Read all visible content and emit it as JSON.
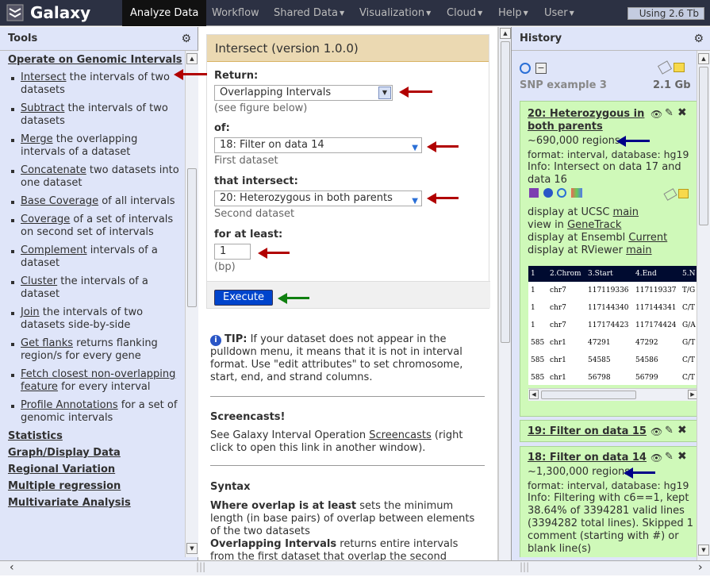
{
  "masthead": {
    "brand": "Galaxy",
    "nav": [
      "Analyze Data",
      "Workflow",
      "Shared Data",
      "Visualization",
      "Cloud",
      "Help",
      "User"
    ],
    "quota": "Using 2.6 Tb"
  },
  "tools_panel": {
    "title": "Tools",
    "section_title": "Operate on Genomic Intervals",
    "tools": [
      {
        "link": "Intersect",
        "rest": " the intervals of two datasets"
      },
      {
        "link": "Subtract",
        "rest": " the intervals of two datasets"
      },
      {
        "link": "Merge",
        "rest": " the overlapping intervals of a dataset"
      },
      {
        "link": "Concatenate",
        "rest": " two datasets into one dataset"
      },
      {
        "link": "Base Coverage",
        "rest": " of all intervals"
      },
      {
        "link": "Coverage",
        "rest": " of a set of intervals on second set of intervals"
      },
      {
        "link": "Complement",
        "rest": " intervals of a dataset"
      },
      {
        "link": "Cluster",
        "rest": " the intervals of a dataset"
      },
      {
        "link": "Join",
        "rest": " the intervals of two datasets side-by-side"
      },
      {
        "link": "Get flanks",
        "rest": " returns flanking region/s for every gene"
      },
      {
        "link": "Fetch closest non-overlapping feature",
        "rest": " for every interval"
      },
      {
        "link": "Profile Annotations",
        "rest": " for a set of genomic intervals"
      }
    ],
    "sections": [
      "Statistics",
      "Graph/Display Data",
      "Regional Variation",
      "Multiple regression",
      "Multivariate Analysis"
    ]
  },
  "form": {
    "title": "Intersect (version 1.0.0)",
    "return_label": "Return:",
    "return_value": "Overlapping Intervals",
    "return_hint": "(see figure below)",
    "of_label": "of:",
    "of_value": "18: Filter on data 14",
    "of_hint": "First dataset",
    "intersect_label": "that intersect:",
    "intersect_value": "20: Heterozygous in both parents",
    "intersect_hint": "Second dataset",
    "atleast_label": "for at least:",
    "atleast_value": "1",
    "atleast_hint": "(bp)",
    "execute": "Execute"
  },
  "help": {
    "tip_bold": "TIP:",
    "tip_text": " If your dataset does not appear in the pulldown menu, it means that it is not in interval format. Use \"edit attributes\" to set chromosome, start, end, and strand columns.",
    "screencasts_title": "Screencasts!",
    "screencasts_pre": "See Galaxy Interval Operation ",
    "screencasts_link": "Screencasts",
    "screencasts_post": " (right click to open this link in another window).",
    "syntax_title": "Syntax",
    "s1_bold": "Where overlap is at least",
    "s1_text": " sets the minimum length (in base pairs) of overlap between elements of the two datasets",
    "s2_bold": "Overlapping Intervals",
    "s2_text": " returns entire intervals from the first dataset that overlap the second dataset. The returned intervals are completely unchanged, and this"
  },
  "history": {
    "title": "History",
    "name": "SNP example 3",
    "size": "2.1 Gb",
    "ds20": {
      "title": "20: Heterozygous in both parents",
      "regions": "~690,000 regions",
      "format": "format: interval, database: hg19",
      "info": "Info: Intersect on data 17 and data 16",
      "d1_pre": "display at UCSC ",
      "d1_link": "main",
      "d2_pre": "view in ",
      "d2_link": "GeneTrack",
      "d3_pre": "display at Ensembl ",
      "d3_link": "Current",
      "d4_pre": "display at RViewer ",
      "d4_link": "main",
      "peek_header": [
        "1",
        "2.Chrom",
        "3.Start",
        "4.End",
        "5.N"
      ],
      "peek_rows": [
        [
          "1",
          "chr7",
          "117119336",
          "117119337",
          "T/G"
        ],
        [
          "1",
          "chr7",
          "117144340",
          "117144341",
          "C/T"
        ],
        [
          "1",
          "chr7",
          "117174423",
          "117174424",
          "G/A"
        ],
        [
          "585",
          "chr1",
          "47291",
          "47292",
          "G/T"
        ],
        [
          "585",
          "chr1",
          "54585",
          "54586",
          "C/T"
        ],
        [
          "585",
          "chr1",
          "56798",
          "56799",
          "C/T"
        ]
      ]
    },
    "ds19": {
      "title": "19: Filter on data 15"
    },
    "ds18": {
      "title": "18: Filter on data 14",
      "regions": "~1,300,000 regions",
      "format": "format: interval, database: hg19",
      "info": "Info: Filtering with c6==1, kept 38.64% of 3394281 valid lines (3394282 total lines). Skipped 1 comment (starting with #) or blank line(s)"
    }
  }
}
